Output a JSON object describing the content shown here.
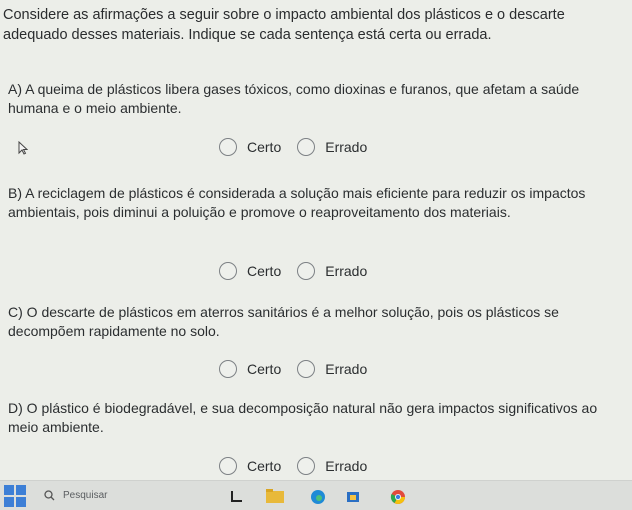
{
  "intro": "Considere as afirmações a seguir sobre o impacto ambiental dos plásticos e o descarte adequado desses materiais. Indique se cada sentença está certa ou errada.",
  "questions": [
    {
      "text": "A) A queima de plásticos libera gases tóxicos, como dioxinas e furanos, que afetam a saúde humana e o meio ambiente.",
      "opt1": "Certo",
      "opt2": "Errado"
    },
    {
      "text": "B) A reciclagem de plásticos é considerada a solução mais eficiente para reduzir os impactos ambientais, pois diminui a poluição e promove o reaproveitamento dos materiais.",
      "opt1": "Certo",
      "opt2": "Errado"
    },
    {
      "text": "C) O descarte de plásticos em aterros sanitários é a melhor solução, pois os plásticos se decompõem rapidamente no solo.",
      "opt1": "Certo",
      "opt2": "Errado"
    },
    {
      "text": "D) O plástico é biodegradável, e sua decomposição natural não gera impactos significativos ao meio ambiente.",
      "opt1": "Certo",
      "opt2": "Errado"
    }
  ],
  "taskbar": {
    "search_placeholder": "Pesquisar",
    "accent": "#3d7fd6"
  }
}
